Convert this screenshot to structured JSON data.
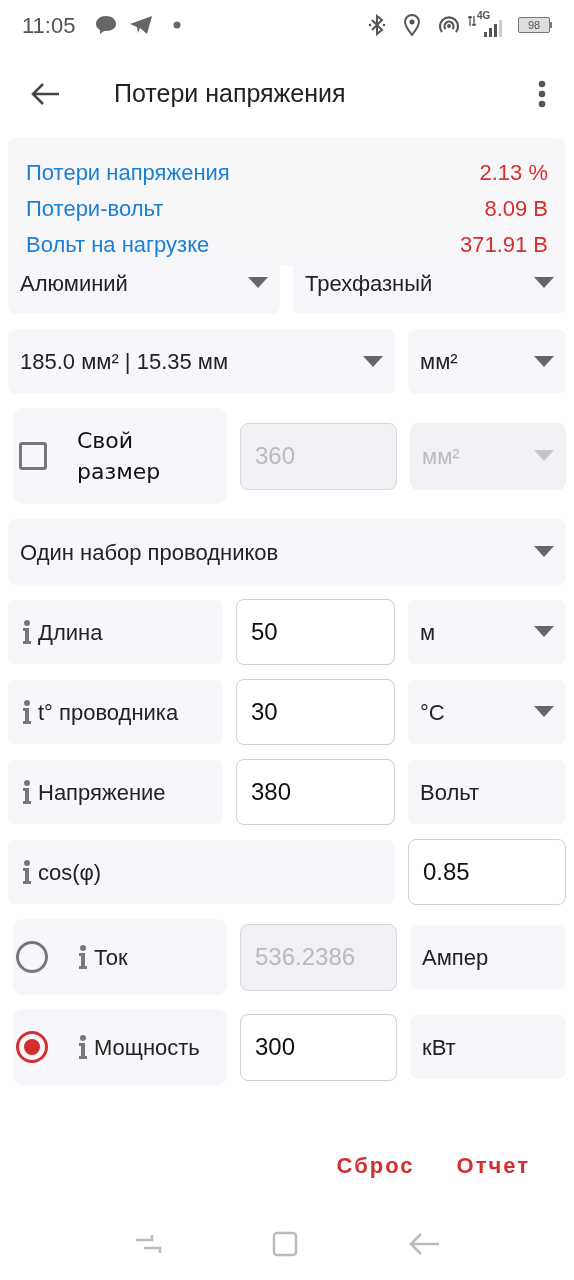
{
  "status_bar": {
    "time": "11:05",
    "network": "4G",
    "battery": "98"
  },
  "app_bar": {
    "title": "Потери напряжения"
  },
  "results": [
    {
      "label": "Потери напряжения",
      "value": "2.13 %"
    },
    {
      "label": "Потери-вольт",
      "value": "8.09 В"
    },
    {
      "label": "Вольт на нагрузке",
      "value": "371.91 В"
    }
  ],
  "material": {
    "value": "Алюминий"
  },
  "phase": {
    "value": "Трехфазный"
  },
  "size": {
    "value": "185.0 мм² | 15.35 мм",
    "unit": "мм²"
  },
  "custom_size": {
    "label": "Свой размер",
    "checked": false,
    "value": "360",
    "unit": "мм²"
  },
  "conductor_sets": {
    "value": "Один набор проводников"
  },
  "parameters": [
    {
      "kind": "dropdown",
      "label": "Длина",
      "value": "50",
      "unit": "м"
    },
    {
      "kind": "dropdown",
      "label": "t° проводника",
      "value": "30",
      "unit": "°C"
    },
    {
      "kind": "text",
      "label": "Напряжение",
      "value": "380",
      "unit": "Вольт"
    },
    {
      "kind": "wide",
      "label": "cos(φ)",
      "value": "0.85"
    }
  ],
  "load": [
    {
      "label": "Ток",
      "value": "536.2386",
      "unit": "Ампер",
      "selected": false
    },
    {
      "label": "Мощность",
      "value": "300",
      "unit": "кВт",
      "selected": true
    }
  ],
  "actions": [
    "Сброс",
    "Отчет"
  ]
}
